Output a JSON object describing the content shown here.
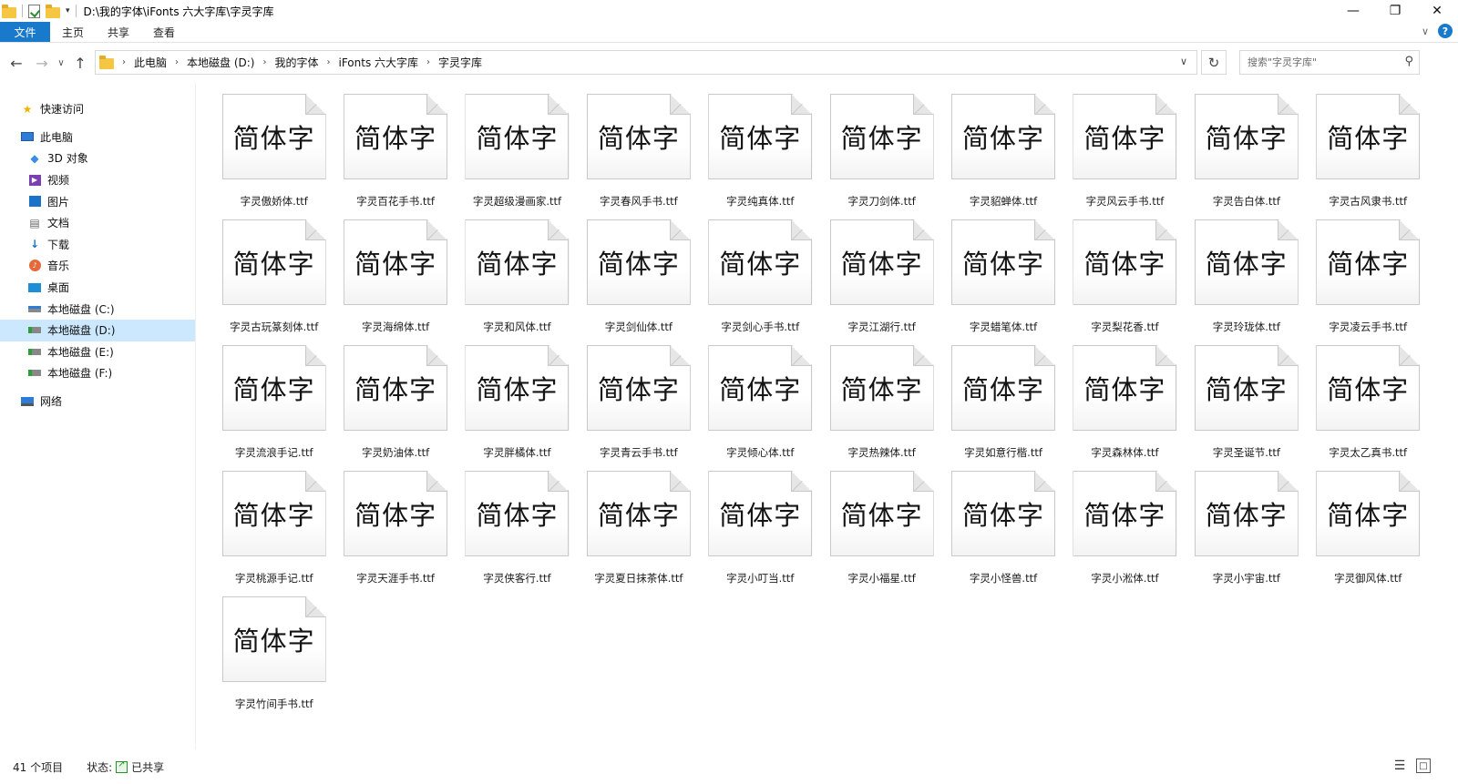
{
  "window": {
    "title": "D:\\我的字体\\iFonts 六大字库\\字灵字库",
    "minimize": "—",
    "maximize": "❐",
    "close": "✕"
  },
  "ribbon": {
    "tabs": [
      "文件",
      "主页",
      "共享",
      "查看"
    ],
    "help": "?"
  },
  "nav": {
    "back": "←",
    "forward": "→",
    "recent": "∨",
    "up": "↑",
    "breadcrumbs": [
      "此电脑",
      "本地磁盘 (D:)",
      "我的字体",
      "iFonts 六大字库",
      "字灵字库"
    ],
    "search_placeholder": "搜索\"字灵字库\""
  },
  "sidebar": {
    "items": [
      {
        "label": "快速访问",
        "icon": "star-icon",
        "level": 0
      },
      {
        "label": "此电脑",
        "icon": "computer-icon",
        "level": 0
      },
      {
        "label": "3D 对象",
        "icon": "cube-3d-icon",
        "level": 1
      },
      {
        "label": "视频",
        "icon": "video-icon",
        "level": 1
      },
      {
        "label": "图片",
        "icon": "pictures-icon",
        "level": 1
      },
      {
        "label": "文档",
        "icon": "documents-icon",
        "level": 1
      },
      {
        "label": "下载",
        "icon": "download-icon",
        "level": 1
      },
      {
        "label": "音乐",
        "icon": "music-icon",
        "level": 1
      },
      {
        "label": "桌面",
        "icon": "desktop-icon",
        "level": 1
      },
      {
        "label": "本地磁盘 (C:)",
        "icon": "drive-icon",
        "level": 1
      },
      {
        "label": "本地磁盘 (D:)",
        "icon": "drive-icon",
        "level": 1,
        "selected": true
      },
      {
        "label": "本地磁盘 (E:)",
        "icon": "drive-icon",
        "level": 1
      },
      {
        "label": "本地磁盘 (F:)",
        "icon": "drive-icon",
        "level": 1
      },
      {
        "label": "网络",
        "icon": "network-icon",
        "level": 0
      }
    ]
  },
  "sample_text": "简体字",
  "files": [
    "字灵傲娇体.ttf",
    "字灵百花手书.ttf",
    "字灵超级漫画家.ttf",
    "字灵春风手书.ttf",
    "字灵纯真体.ttf",
    "字灵刀剑体.ttf",
    "字灵貂蝉体.ttf",
    "字灵风云手书.ttf",
    "字灵告白体.ttf",
    "字灵古风隶书.ttf",
    "字灵古玩篆刻体.ttf",
    "字灵海绵体.ttf",
    "字灵和风体.ttf",
    "字灵剑仙体.ttf",
    "字灵剑心手书.ttf",
    "字灵江湖行.ttf",
    "字灵蜡笔体.ttf",
    "字灵梨花香.ttf",
    "字灵玲珑体.ttf",
    "字灵凌云手书.ttf",
    "字灵流浪手记.ttf",
    "字灵奶油体.ttf",
    "字灵胖橘体.ttf",
    "字灵青云手书.ttf",
    "字灵倾心体.ttf",
    "字灵热辣体.ttf",
    "字灵如意行楷.ttf",
    "字灵森林体.ttf",
    "字灵圣诞节.ttf",
    "字灵太乙真书.ttf",
    "字灵桃源手记.ttf",
    "字灵天涯手书.ttf",
    "字灵侠客行.ttf",
    "字灵夏日抹茶体.ttf",
    "字灵小叮当.ttf",
    "字灵小福星.ttf",
    "字灵小怪兽.ttf",
    "字灵小淞体.ttf",
    "字灵小宇宙.ttf",
    "字灵御风体.ttf",
    "字灵竹间手书.ttf"
  ],
  "status": {
    "count": "41 个项目",
    "state_label": "状态:",
    "state_value": "已共享"
  },
  "colors": {
    "accent": "#1979ca",
    "selection": "#cce8ff"
  }
}
